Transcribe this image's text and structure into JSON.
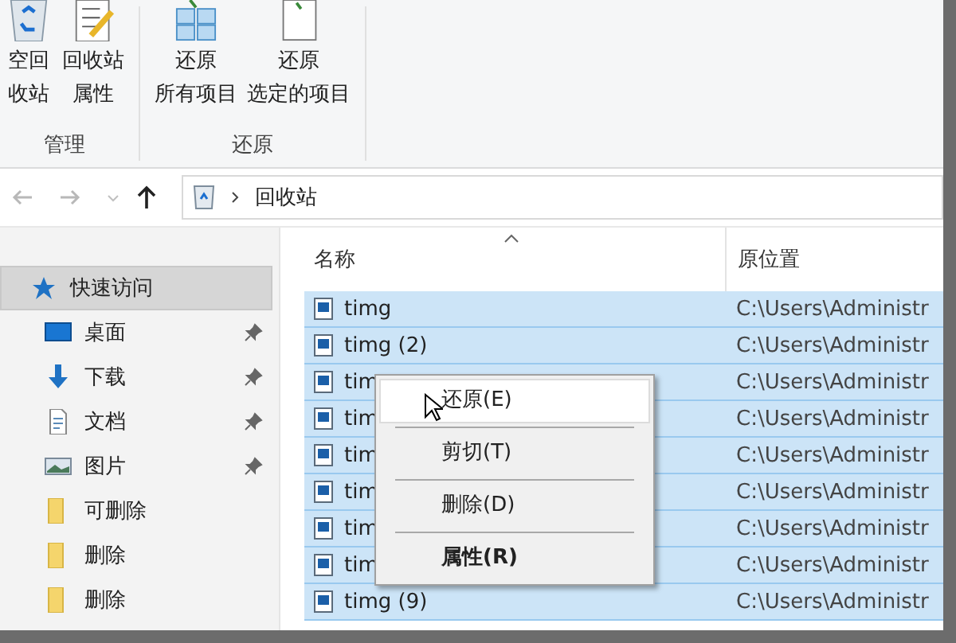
{
  "ribbon": {
    "groups": [
      {
        "label": "管理",
        "buttons": [
          {
            "lines": [
              "空回",
              "收站"
            ]
          },
          {
            "lines": [
              "回收站",
              "属性"
            ]
          }
        ]
      },
      {
        "label": "还原",
        "buttons": [
          {
            "lines": [
              "还原",
              "所有项目"
            ]
          },
          {
            "lines": [
              "还原",
              "选定的项目"
            ]
          }
        ]
      }
    ]
  },
  "address": {
    "path": "回收站"
  },
  "sidebar": {
    "items": [
      {
        "label": "快速访问",
        "selected": true,
        "pinned": false
      },
      {
        "label": "桌面",
        "selected": false,
        "pinned": true
      },
      {
        "label": "下载",
        "selected": false,
        "pinned": true
      },
      {
        "label": "文档",
        "selected": false,
        "pinned": true
      },
      {
        "label": "图片",
        "selected": false,
        "pinned": true
      },
      {
        "label": "可删除",
        "selected": false,
        "pinned": false
      },
      {
        "label": "删除",
        "selected": false,
        "pinned": false
      },
      {
        "label": "删除",
        "selected": false,
        "pinned": false
      }
    ]
  },
  "table": {
    "columns": [
      "名称",
      "原位置"
    ],
    "rows": [
      {
        "name": "timg",
        "location": "C:\\Users\\Administr",
        "selected": true
      },
      {
        "name": "timg (2)",
        "location": "C:\\Users\\Administr",
        "selected": true
      },
      {
        "name": "tim",
        "location": "C:\\Users\\Administr",
        "selected": true
      },
      {
        "name": "tim",
        "location": "C:\\Users\\Administr",
        "selected": true
      },
      {
        "name": "tim",
        "location": "C:\\Users\\Administr",
        "selected": true
      },
      {
        "name": "tim",
        "location": "C:\\Users\\Administr",
        "selected": true
      },
      {
        "name": "tim",
        "location": "C:\\Users\\Administr",
        "selected": true
      },
      {
        "name": "tim",
        "location": "C:\\Users\\Administr",
        "selected": true
      },
      {
        "name": "timg (9)",
        "location": "C:\\Users\\Administr",
        "selected": true
      }
    ]
  },
  "context_menu": {
    "items": [
      {
        "label": "还原(E)",
        "selected": true,
        "bold": false
      },
      {
        "label": "剪切(T)",
        "selected": false,
        "bold": false
      },
      {
        "label": "删除(D)",
        "selected": false,
        "bold": false
      },
      {
        "label": "属性(R)",
        "selected": false,
        "bold": true
      }
    ]
  }
}
